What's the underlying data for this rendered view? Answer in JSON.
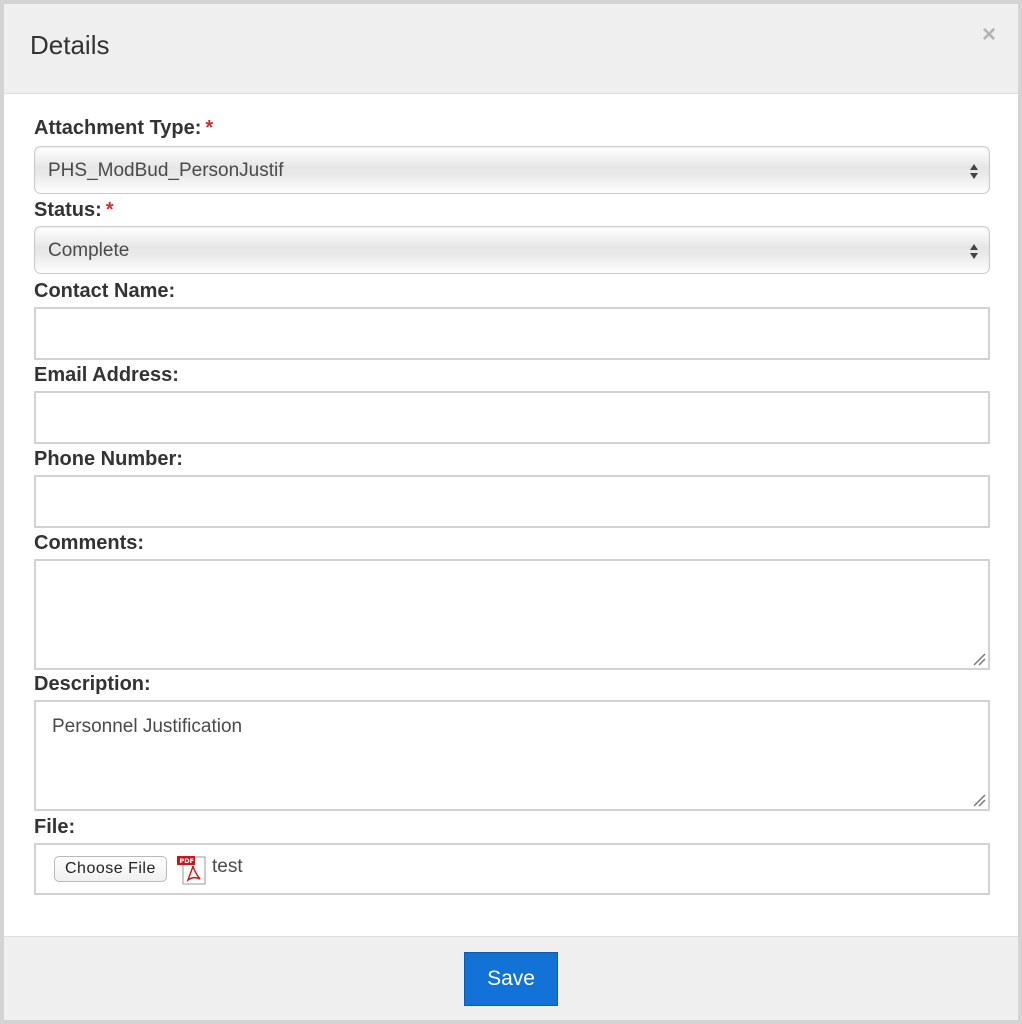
{
  "dialog": {
    "title": "Details",
    "close_symbol": "×"
  },
  "form": {
    "attachment_type": {
      "label": "Attachment Type:",
      "required_mark": "*",
      "value": "PHS_ModBud_PersonJustif"
    },
    "status": {
      "label": "Status:",
      "required_mark": "*",
      "value": "Complete"
    },
    "contact_name": {
      "label": "Contact Name:",
      "value": ""
    },
    "email_address": {
      "label": "Email Address:",
      "value": ""
    },
    "phone_number": {
      "label": "Phone Number:",
      "value": ""
    },
    "comments": {
      "label": "Comments:",
      "value": ""
    },
    "description": {
      "label": "Description:",
      "value": "Personnel Justification"
    },
    "file": {
      "label": "File:",
      "button_label": "Choose File",
      "icon": "pdf-file-icon",
      "file_name": "test"
    }
  },
  "footer": {
    "save_label": "Save"
  },
  "colors": {
    "accent": "#1372d6",
    "required": "#c9302c",
    "header_bg": "#efefef"
  }
}
